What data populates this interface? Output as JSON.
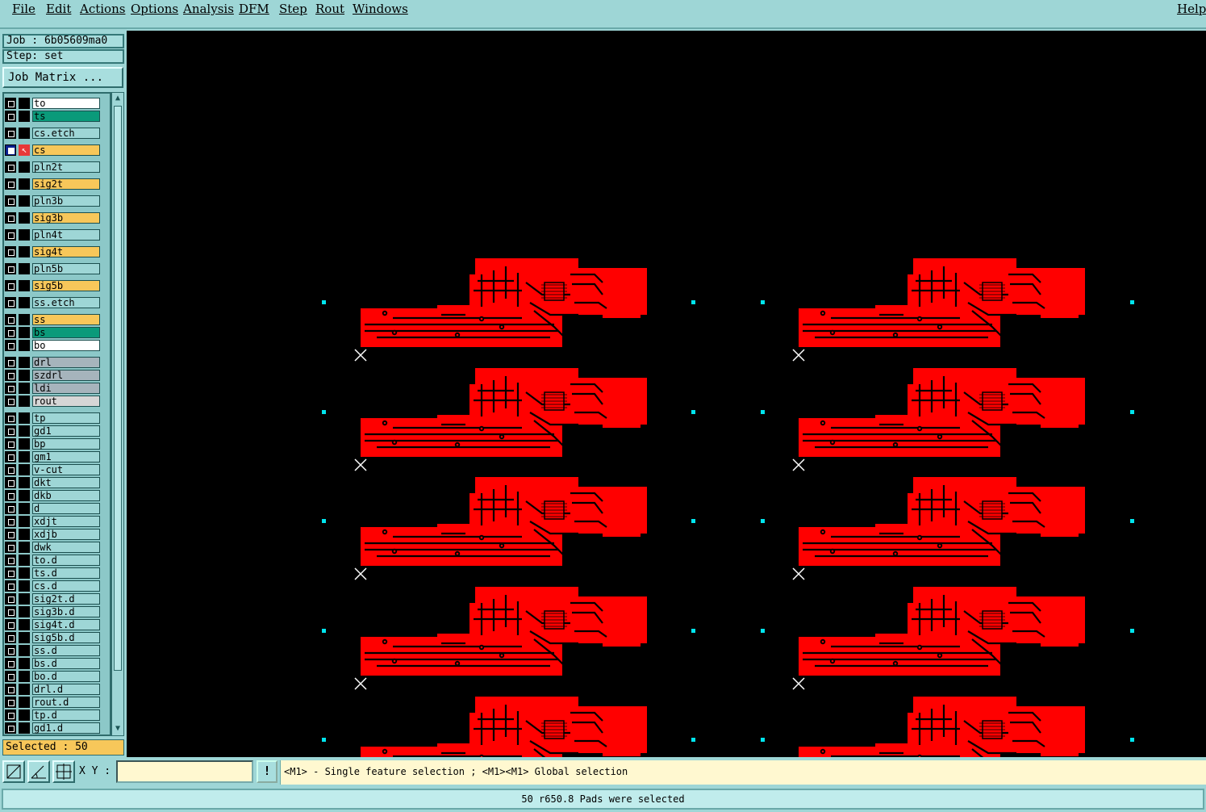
{
  "menu": {
    "items": [
      "File",
      "Edit",
      "Actions",
      "Options",
      "Analysis",
      "DFM",
      "Step",
      "Rout",
      "Windows"
    ],
    "help": "Help"
  },
  "job": {
    "job_label": "Job : 6b05609ma0",
    "step_label": "Step: set"
  },
  "job_matrix_button": "Job Matrix ...",
  "layers": [
    {
      "name": "to",
      "color": "#ffffff"
    },
    {
      "name": "ts",
      "color": "#0a9a7a"
    },
    {
      "name": "cs.etch",
      "color": "#9ed6d6"
    },
    {
      "name": "cs",
      "color": "#f7c75a",
      "active": true
    },
    {
      "name": "pln2t",
      "color": "#9ed6d6"
    },
    {
      "name": "sig2t",
      "color": "#f7c75a"
    },
    {
      "name": "pln3b",
      "color": "#9ed6d6"
    },
    {
      "name": "sig3b",
      "color": "#f7c75a"
    },
    {
      "name": "pln4t",
      "color": "#9ed6d6"
    },
    {
      "name": "sig4t",
      "color": "#f7c75a"
    },
    {
      "name": "pln5b",
      "color": "#9ed6d6"
    },
    {
      "name": "sig5b",
      "color": "#f7c75a"
    },
    {
      "name": "ss.etch",
      "color": "#9ed6d6"
    },
    {
      "name": "ss",
      "color": "#f7c75a"
    },
    {
      "name": "bs",
      "color": "#0a9a7a"
    },
    {
      "name": "bo",
      "color": "#ffffff"
    },
    {
      "name": "drl",
      "color": "#a6b4bc"
    },
    {
      "name": "szdrl",
      "color": "#a6b4bc"
    },
    {
      "name": "ldi",
      "color": "#a6b4bc"
    },
    {
      "name": "rout",
      "color": "#d6d6d6"
    },
    {
      "name": "tp",
      "color": "#9ed6d6"
    },
    {
      "name": "gd1",
      "color": "#9ed6d6"
    },
    {
      "name": "bp",
      "color": "#9ed6d6"
    },
    {
      "name": "gm1",
      "color": "#9ed6d6"
    },
    {
      "name": "v-cut",
      "color": "#9ed6d6"
    },
    {
      "name": "dkt",
      "color": "#9ed6d6"
    },
    {
      "name": "dkb",
      "color": "#9ed6d6"
    },
    {
      "name": "d",
      "color": "#9ed6d6"
    },
    {
      "name": "xdjt",
      "color": "#9ed6d6"
    },
    {
      "name": "xdjb",
      "color": "#9ed6d6"
    },
    {
      "name": "dwk",
      "color": "#9ed6d6"
    },
    {
      "name": "to.d",
      "color": "#9ed6d6"
    },
    {
      "name": "ts.d",
      "color": "#9ed6d6"
    },
    {
      "name": "cs.d",
      "color": "#9ed6d6"
    },
    {
      "name": "sig2t.d",
      "color": "#9ed6d6"
    },
    {
      "name": "sig3b.d",
      "color": "#9ed6d6"
    },
    {
      "name": "sig4t.d",
      "color": "#9ed6d6"
    },
    {
      "name": "sig5b.d",
      "color": "#9ed6d6"
    },
    {
      "name": "ss.d",
      "color": "#9ed6d6"
    },
    {
      "name": "bs.d",
      "color": "#9ed6d6"
    },
    {
      "name": "bo.d",
      "color": "#9ed6d6"
    },
    {
      "name": "drl.d",
      "color": "#9ed6d6"
    },
    {
      "name": "rout.d",
      "color": "#9ed6d6"
    },
    {
      "name": "tp.d",
      "color": "#9ed6d6"
    },
    {
      "name": "gd1.d",
      "color": "#9ed6d6"
    }
  ],
  "selected_label": "Selected : 50",
  "toolbar": {
    "xy_label": "X Y :",
    "xy_value": "",
    "excl_label": "!",
    "hint": "<M1> - Single feature selection ; <M1><M1> Global selection"
  },
  "status": "50 r650.8 Pads were selected",
  "colors": {
    "board": "#ff0000",
    "fiducial": "#00e5ee",
    "canvas_bg": "#000000"
  }
}
